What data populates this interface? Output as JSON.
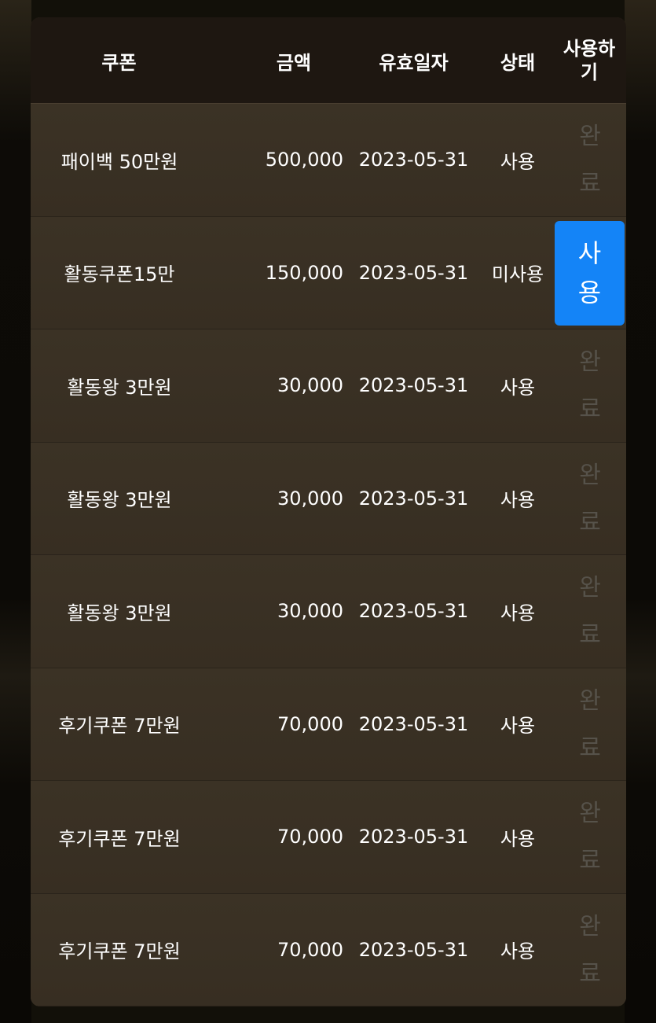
{
  "table": {
    "headers": {
      "coupon": "쿠폰",
      "amount": "금액",
      "expiry": "유효일자",
      "status": "상태",
      "use_line1": "사용하",
      "use_line2": "기"
    },
    "done_label": {
      "line1": "완",
      "line2": "료"
    },
    "use_button_label": {
      "line1": "사",
      "line2": "용"
    },
    "rows": [
      {
        "coupon": "패이백 50만원",
        "amount": "500,000",
        "expiry": "2023-05-31",
        "status": "사용",
        "action": "done"
      },
      {
        "coupon": "활동쿠폰15만",
        "amount": "150,000",
        "expiry": "2023-05-31",
        "status": "미사용",
        "action": "use"
      },
      {
        "coupon": "활동왕 3만원",
        "amount": "30,000",
        "expiry": "2023-05-31",
        "status": "사용",
        "action": "done"
      },
      {
        "coupon": "활동왕 3만원",
        "amount": "30,000",
        "expiry": "2023-05-31",
        "status": "사용",
        "action": "done"
      },
      {
        "coupon": "활동왕 3만원",
        "amount": "30,000",
        "expiry": "2023-05-31",
        "status": "사용",
        "action": "done"
      },
      {
        "coupon": "후기쿠폰 7만원",
        "amount": "70,000",
        "expiry": "2023-05-31",
        "status": "사용",
        "action": "done"
      },
      {
        "coupon": "후기쿠폰 7만원",
        "amount": "70,000",
        "expiry": "2023-05-31",
        "status": "사용",
        "action": "done"
      },
      {
        "coupon": "후기쿠폰 7만원",
        "amount": "70,000",
        "expiry": "2023-05-31",
        "status": "사용",
        "action": "done"
      }
    ]
  },
  "colors": {
    "header_bg": "#1e1711",
    "row_bg": "#3a3124",
    "use_button": "#1484f7",
    "done_text": "#56524a",
    "text": "#ffffff"
  }
}
